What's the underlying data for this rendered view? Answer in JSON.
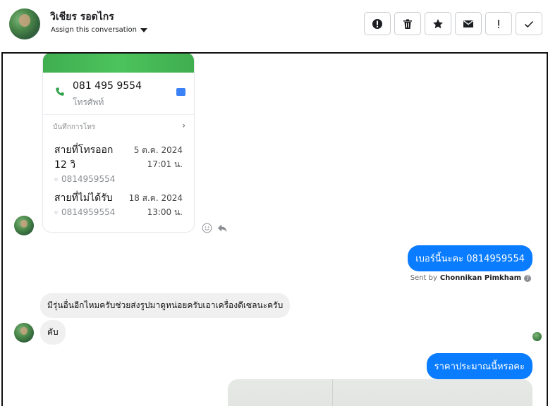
{
  "header": {
    "contact_name": "วิเชียร รอดไกร",
    "assign_label": "Assign this conversation",
    "toolbar": [
      "important-icon",
      "trash-icon",
      "star-icon",
      "mail-icon",
      "exclamation-icon",
      "check-icon"
    ]
  },
  "contact_card": {
    "phone_number": "081 495 9554",
    "phone_label": "โทรศัพท์",
    "log_title": "บันทึกการโทร",
    "calls": [
      {
        "title_line1": "สายที่โทรออก",
        "title_line2": "12 วิ",
        "date": "5 ต.ค. 2024",
        "time": "17:01 น.",
        "number": "0814959554"
      },
      {
        "title_line1": "สายที่ไม่ได้รับ",
        "title_line2": "",
        "date": "18 ส.ค. 2024",
        "time": "13:00 น.",
        "number": "0814959554"
      }
    ]
  },
  "messages": {
    "outgoing_1": "เบอร์นี้นะคะ 0814959554",
    "sent_by_prefix": "Sent by",
    "sent_by_name": "Chonnikan Pimkham",
    "incoming_1": "มีรุ่นอื่นอีกไหมครับช่วยส่งรูปมาดูหน่อยครับเอาเครื่องดีเซลนะครับ",
    "incoming_2": "คับ",
    "outgoing_2": "ราคาประมาณนี้หรอคะ"
  }
}
